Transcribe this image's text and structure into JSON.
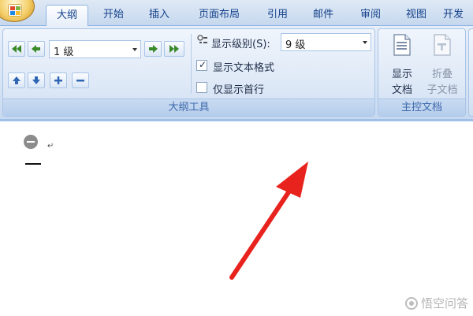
{
  "tabs": [
    {
      "label": "大纲",
      "active": true
    },
    {
      "label": "开始"
    },
    {
      "label": "插入"
    },
    {
      "label": "页面布局"
    },
    {
      "label": "引用"
    },
    {
      "label": "邮件"
    },
    {
      "label": "审阅"
    },
    {
      "label": "视图"
    },
    {
      "label": "开发"
    }
  ],
  "outline_tools": {
    "group_label": "大纲工具",
    "level_value": "1 级",
    "show_level_label": "显示级别(S):",
    "show_level_value": "9 级",
    "show_text_formatting_label": "显示文本格式",
    "show_text_formatting_checked": true,
    "show_first_line_only_label": "仅显示首行",
    "show_first_line_only_checked": false,
    "tick_mark": "✓"
  },
  "master_document": {
    "group_label": "主控文档",
    "show_document_line1": "显示",
    "show_document_line2": "文档",
    "collapse_line1": "折叠",
    "collapse_line2": "子文档"
  },
  "document": {
    "paragraph_mark": "↵"
  },
  "watermark": {
    "text": "悟空问答"
  },
  "colors": {
    "arrow": "#e8231e",
    "ribbon_text": "#15428b"
  }
}
